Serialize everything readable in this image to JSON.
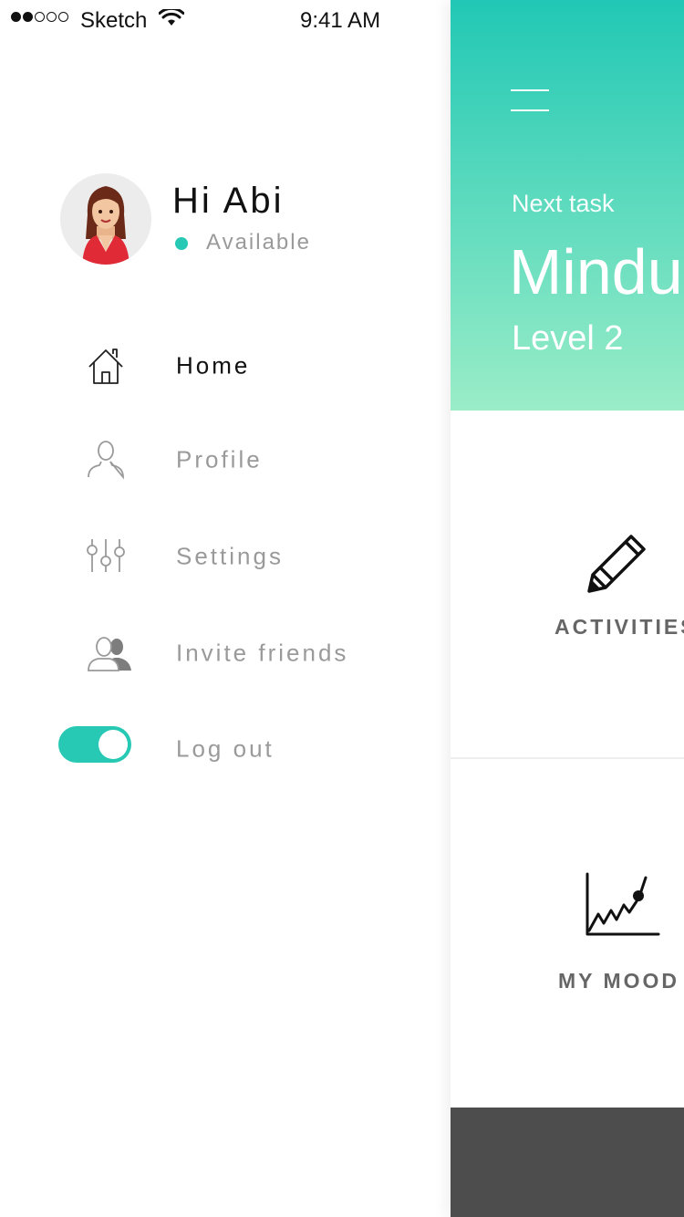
{
  "status_bar": {
    "carrier": "Sketch",
    "time": "9:41 AM",
    "signal_icon": "signal-dots-icon",
    "wifi_icon": "wifi-icon"
  },
  "drawer": {
    "greeting": "Hi Abi",
    "status": "Available",
    "status_color": "#27c9b4",
    "menu": [
      {
        "label": "Home",
        "icon": "home-icon",
        "active": true
      },
      {
        "label": "Profile",
        "icon": "user-icon",
        "active": false
      },
      {
        "label": "Settings",
        "icon": "sliders-icon",
        "active": false
      },
      {
        "label": "Invite friends",
        "icon": "users-icon",
        "active": false
      },
      {
        "label": "Log out",
        "icon": "toggle-switch",
        "active": false
      }
    ],
    "logout_toggle_on": true
  },
  "main": {
    "next_task_label": "Next task",
    "task_title": "Mindu",
    "task_level": "Level 2",
    "tiles": [
      {
        "label": "ACTIVITIES",
        "icon": "pencil-icon"
      },
      {
        "label": "MY MOOD",
        "icon": "line-chart-icon"
      }
    ]
  },
  "colors": {
    "accent": "#27c9b4",
    "hero_top": "#21c8b5",
    "hero_bottom": "#9aedc7",
    "bottom_bar": "#4d4d4d"
  }
}
